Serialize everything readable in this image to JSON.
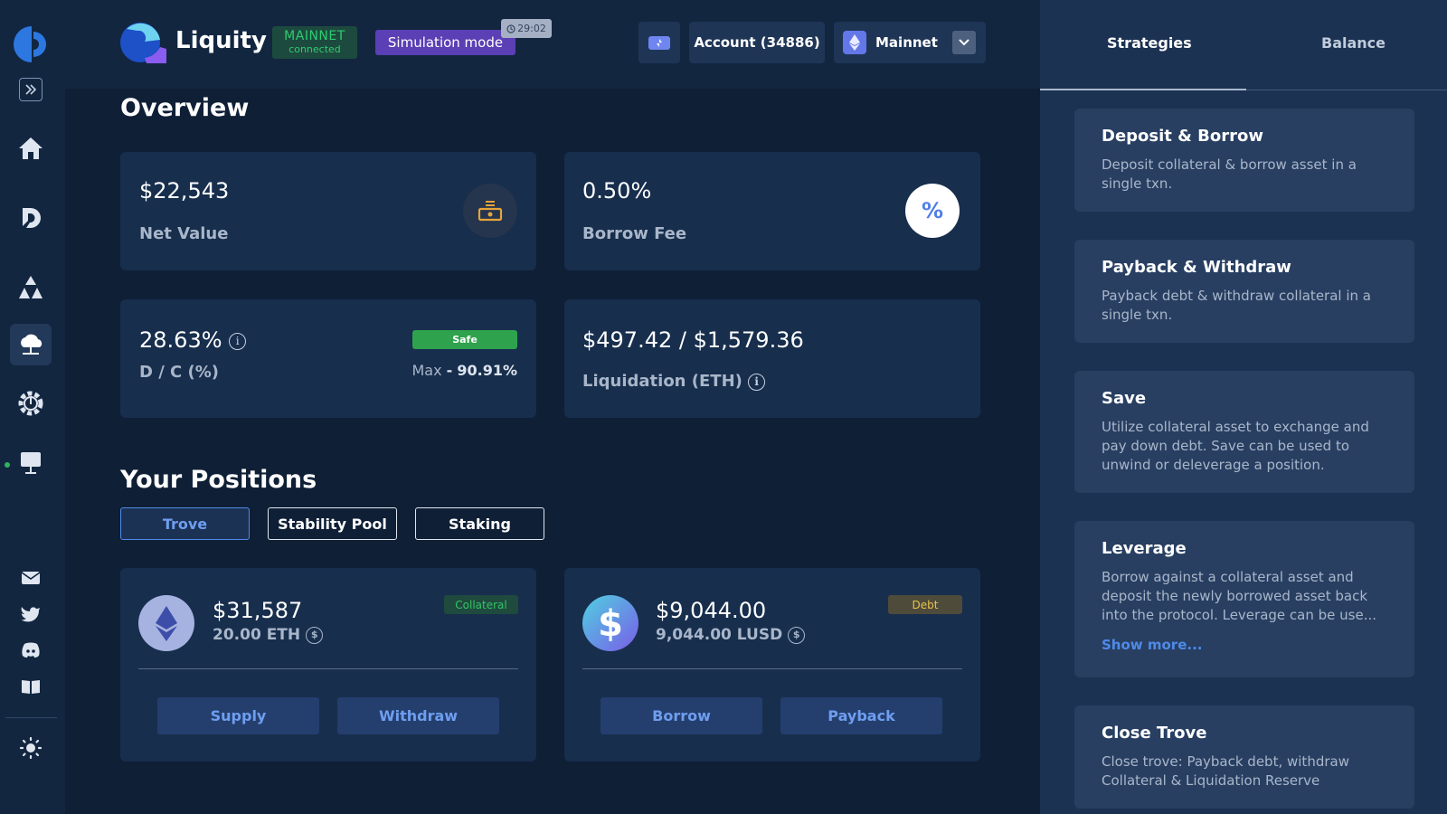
{
  "header": {
    "app_name": "Liquity",
    "network_badge": {
      "line1": "MAINNET",
      "line2": "connected"
    },
    "simulation": "Simulation mode",
    "timer": "29:02",
    "account": "Account (34886)",
    "network_select": "Mainnet"
  },
  "overview": {
    "title": "Overview",
    "net_value": {
      "value": "$22,543",
      "label": "Net Value"
    },
    "borrow_fee": {
      "value": "0.50%",
      "label": "Borrow Fee"
    },
    "dc_ratio": {
      "value": "28.63%",
      "label": "D / C (%)",
      "badge": "Safe",
      "max_label": "Max",
      "max_sep": "-",
      "max_value": "90.91%"
    },
    "liquidation": {
      "value": "$497.42 / $1,579.36",
      "label": "Liquidation (ETH)"
    }
  },
  "positions": {
    "title": "Your Positions",
    "tabs": [
      "Trove",
      "Stability Pool",
      "Staking"
    ],
    "collateral": {
      "amount": "$31,587",
      "sub": "20.00 ETH",
      "tag": "Collateral",
      "btn1": "Supply",
      "btn2": "Withdraw"
    },
    "debt": {
      "amount": "$9,044.00",
      "sub": "9,044.00 LUSD",
      "tag": "Debt",
      "btn1": "Borrow",
      "btn2": "Payback"
    }
  },
  "right_panel": {
    "tabs": [
      "Strategies",
      "Balance"
    ],
    "strategies": [
      {
        "title": "Deposit & Borrow",
        "desc": "Deposit collateral & borrow asset in a single txn."
      },
      {
        "title": "Payback & Withdraw",
        "desc": "Payback debt & withdraw collateral in a single txn."
      },
      {
        "title": "Save",
        "desc": "Utilize collateral asset to exchange and pay down debt. Save can be used to unwind or deleverage a position."
      },
      {
        "title": "Leverage",
        "desc": "Borrow against a collateral asset and deposit the newly borrowed asset back into the protocol. Leverage can be use...",
        "more": "Show more..."
      },
      {
        "title": "Close Trove",
        "desc": "Close trove: Payback debt, withdraw Collateral & Liquidation Reserve"
      }
    ]
  },
  "colors": {
    "background": "#0f1f36",
    "card": "#172e4d",
    "accent_blue": "#4f8ae8",
    "safe_green": "#2fa24d",
    "simulation_purple": "#5b3fb4"
  },
  "icons": {
    "rail": [
      "app-logo-icon",
      "expand-icon",
      "home-icon",
      "defisaver-icon",
      "triangles-icon",
      "cloud-icon",
      "gear-icon",
      "terminal-icon",
      "mail-icon",
      "twitter-icon",
      "discord-icon",
      "book-icon",
      "sun-icon"
    ]
  }
}
